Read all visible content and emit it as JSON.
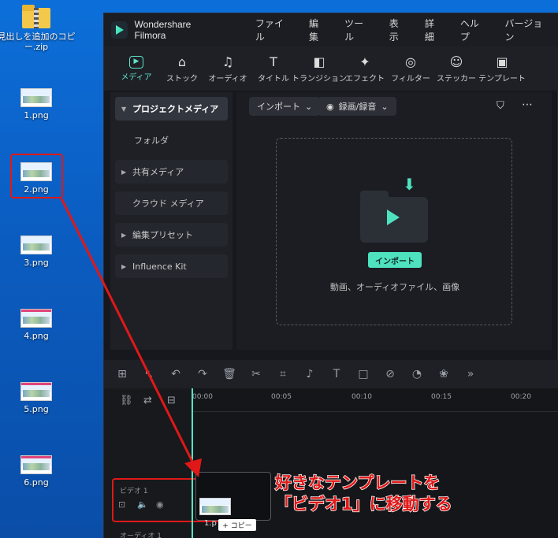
{
  "desktop": {
    "icons": [
      {
        "label": "見出しを追加のコピ\nー.zip"
      },
      {
        "label": "1.png"
      },
      {
        "label": "2.png"
      },
      {
        "label": "3.png"
      },
      {
        "label": "4.png"
      },
      {
        "label": "5.png"
      },
      {
        "label": "6.png"
      }
    ]
  },
  "app": {
    "title": "Wondershare Filmora",
    "menu": [
      "ファイル",
      "編集",
      "ツール",
      "表示",
      "詳細",
      "ヘルプ",
      "バージョン"
    ],
    "toolbar": [
      {
        "label": "メディア",
        "icon": "media-icon"
      },
      {
        "label": "ストック",
        "icon": "stock-icon"
      },
      {
        "label": "オーディオ",
        "icon": "audio-icon"
      },
      {
        "label": "タイトル",
        "icon": "title-icon"
      },
      {
        "label": "トランジション",
        "icon": "transition-icon"
      },
      {
        "label": "エフェクト",
        "icon": "effect-icon"
      },
      {
        "label": "フィルター",
        "icon": "filter-icon"
      },
      {
        "label": "ステッカー",
        "icon": "sticker-icon"
      },
      {
        "label": "テンプレート",
        "icon": "template-icon"
      }
    ],
    "sidebar": [
      {
        "label": "プロジェクトメディア"
      },
      {
        "label": "フォルダ"
      },
      {
        "label": "共有メディア"
      },
      {
        "label": "クラウド メディア"
      },
      {
        "label": "編集プリセット"
      },
      {
        "label": "Influence Kit"
      }
    ],
    "media": {
      "import_dropdown": "インポート",
      "record_dropdown": "録画/録音",
      "import_button": "インポート",
      "drop_hint": "動画、オーディオファイル、画像"
    },
    "timeline": {
      "ticks": [
        "00:00",
        "00:05",
        "00:10",
        "00:15",
        "00:20"
      ],
      "video_track": "ビデオ 1",
      "audio_track": "オーディオ 1",
      "clip_name": "1.p",
      "copy_tag": "+ コピー"
    }
  },
  "annotation": {
    "line1": "好きなテンプレートを",
    "line2": "「ビデオ1」に移動する"
  },
  "colors": {
    "accent": "#5ee2c8",
    "highlight": "#e01818"
  }
}
